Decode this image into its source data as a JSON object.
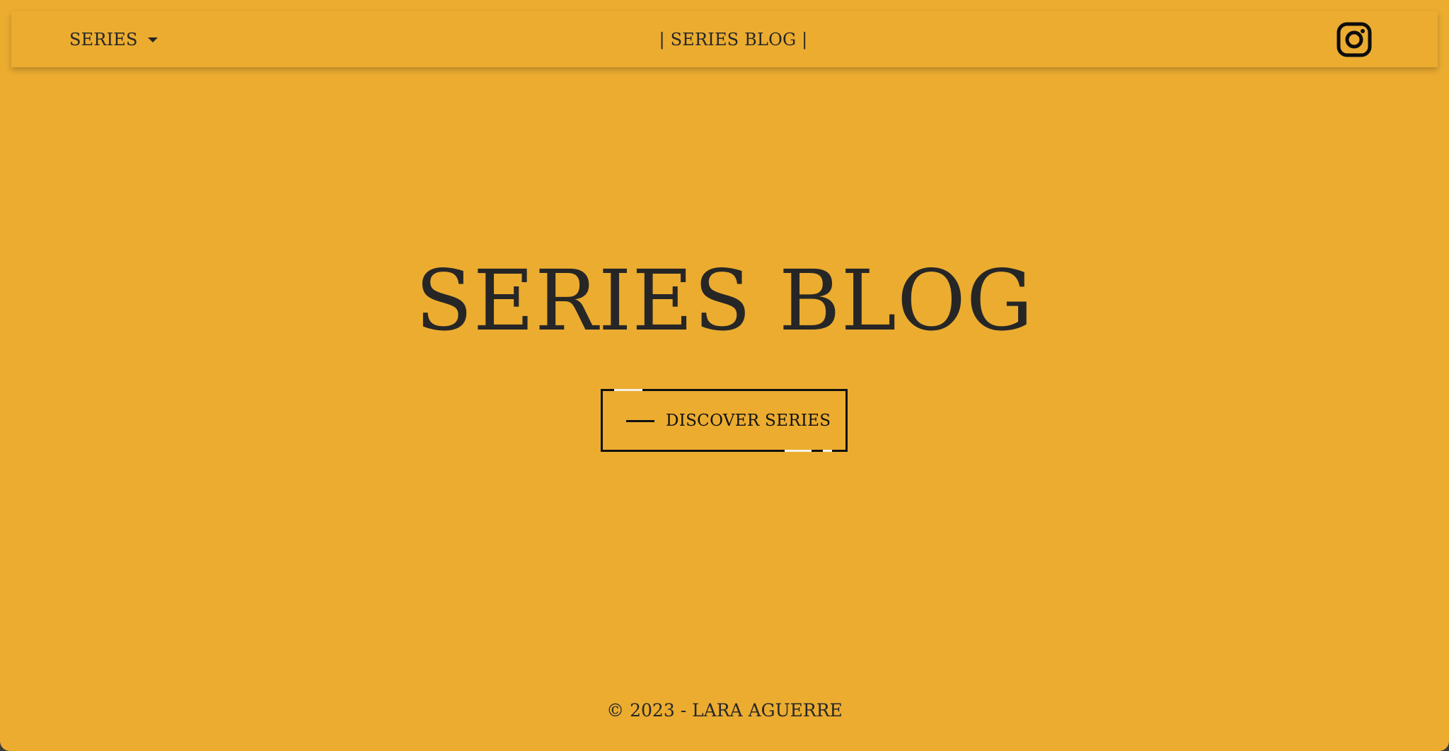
{
  "navbar": {
    "dropdown_label": "SERIES",
    "brand": "| SERIES BLOG |",
    "social_icon": "instagram-icon"
  },
  "hero": {
    "title": "SERIES BLOG",
    "cta_label": "DISCOVER SERIES"
  },
  "footer": {
    "copyright": "© 2023 - LARA AGUERRE"
  },
  "colors": {
    "background": "#ebac30",
    "text": "#262626",
    "border": "#111111"
  }
}
